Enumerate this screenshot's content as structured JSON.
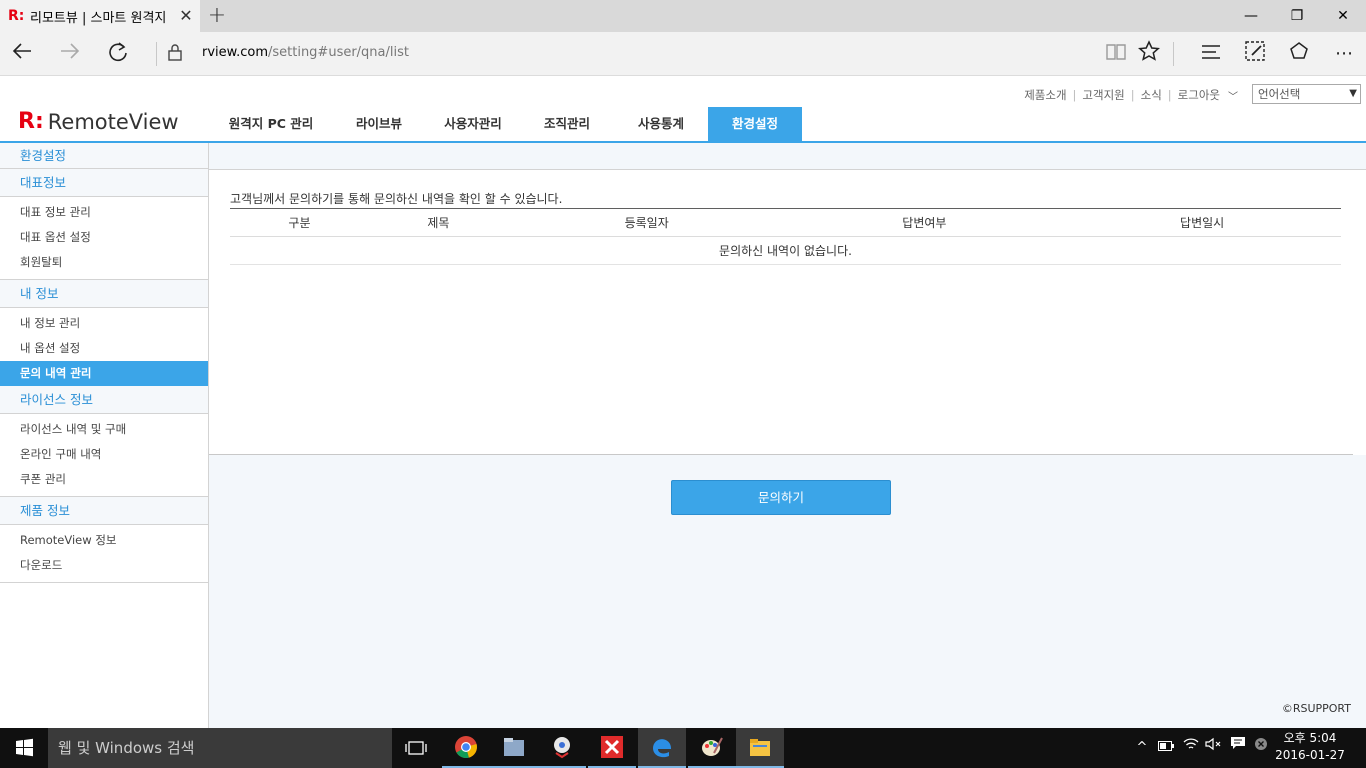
{
  "browser": {
    "tab_title": "리모트뷰 | 스마트 원격지",
    "tab_logo": "R:",
    "address_domain": "rview.com",
    "address_path": "/setting#user/qna/list",
    "new_tab_icon": "+"
  },
  "top_links": [
    "제품소개",
    "고객지원",
    "소식",
    "로그아웃"
  ],
  "language_select": "언어선택",
  "logo_text": "RemoteView",
  "logo_mark": "R:",
  "gnb": [
    "원격지 PC 관리",
    "라이브뷰",
    "사용자관리",
    "조직관리",
    "사용통계",
    "환경설정"
  ],
  "lnb": {
    "title": "환경설정",
    "sections": [
      {
        "header": "대표정보",
        "items": [
          "대표 정보 관리",
          "대표 옵션 설정",
          "회원탈퇴"
        ]
      },
      {
        "header": "내 정보",
        "items": [
          "내 정보 관리",
          "내 옵션 설정",
          "문의 내역 관리"
        ]
      },
      {
        "header": "라이선스 정보",
        "items": [
          "라이선스 내역 및 구매",
          "온라인 구매 내역",
          "쿠폰 관리"
        ]
      },
      {
        "header": "제품 정보",
        "items": [
          "RemoteView 정보",
          "다운로드"
        ]
      }
    ]
  },
  "main": {
    "description": "고객님께서 문의하기를 통해 문의하신 내역을 확인 할 수 있습니다.",
    "columns": [
      "구분",
      "제목",
      "등록일자",
      "답변여부",
      "답변일시"
    ],
    "empty_message": "문의하신 내역이 없습니다.",
    "ask_button": "문의하기",
    "copyright": "©RSUPPORT"
  },
  "taskbar": {
    "search_placeholder": "웹 및 Windows 검색",
    "time": "오후 5:04",
    "date": "2016-01-27"
  },
  "colors": {
    "accent": "#3ba5e8",
    "brand_red": "#e60012"
  }
}
